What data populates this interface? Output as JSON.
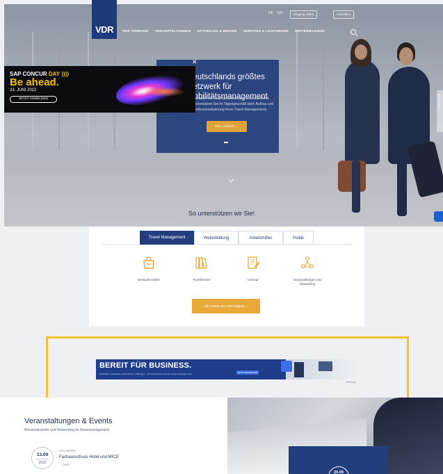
{
  "topbar": {
    "lang_de": "DE",
    "lang_en": "EN",
    "login_label": "Eingang Intern",
    "account_label": "Anmelden"
  },
  "logo": {
    "text": "VDR"
  },
  "nav": {
    "items": [
      "DER VERBAND",
      "VERANSTALTUNGEN",
      "AKTUELLES & MEDIEN",
      "SERVICES & LEISTUNGEN",
      "WEITERBILDUNG"
    ]
  },
  "hero": {
    "headline": "Deutschlands größtes Netzwerk für Mobilitätsmanagement",
    "body": "Der Verband der Geschäftsreisenden in Deutschland. Wir unterstützen Sie im Tagesgeschäft beim Aufbau und der Professionalisierung Ihres Travel Managements.",
    "button_label": "Mehr erfahren  →",
    "kontakt_label": "KONTAKT"
  },
  "sap_ad": {
    "line1_a": "SAP CONCUR",
    "line1_b": "DAY",
    "line1_c": "))))",
    "headline": "Be ahead.",
    "date": "23. JUNI 2022",
    "button_label": "JETZT ANMELDEN",
    "close_label": "✕"
  },
  "support": {
    "title": "So unterstützen wir Sie!",
    "tabs": [
      "Travel Management",
      "Weiterbildung",
      "Arbeitshilfen",
      "Politik"
    ],
    "active_tab": 0,
    "features": [
      {
        "label": "Einkaufsvorteile",
        "icon": "shopping-bag-icon"
      },
      {
        "label": "Fachthemen",
        "icon": "books-icon"
      },
      {
        "label": "Glossar",
        "icon": "edit-document-icon"
      },
      {
        "label": "Veranstaltungen und Networking",
        "icon": "network-people-icon"
      }
    ],
    "cta_label": "Alle Vorteile als VDR-Mitglied  →",
    "accent": "#e8a93a"
  },
  "banner": {
    "headline": "BEREIT FÜR BUSINESS.",
    "subline": "Lieferkette, Lieferketten, Dienstreisen, Zahlungen – für Unternehmen mit den besten Lösungen wird.",
    "button_label": "JETZT ENTDECKEN",
    "werbung_label": "Werbung",
    "highlight_color": "#f5c12a"
  },
  "events": {
    "title": "Veranstaltungen & Events",
    "subtitle": "Wissenstransfer und Networking im Reisemanagement",
    "items": [
      {
        "date": "13.09",
        "year": "2022",
        "location": "ESCHBORN",
        "title": "Fachausschuss Hotel und MICE",
        "more": "→  mehr"
      }
    ],
    "featured_date": "20.09"
  },
  "colors": {
    "brand": "#233e7c",
    "logo": "#1e3a7a"
  }
}
